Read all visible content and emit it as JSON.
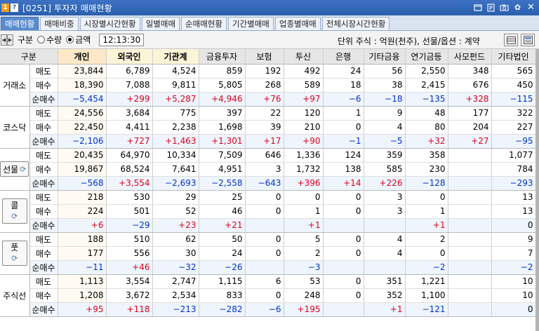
{
  "titlebar": {
    "badge1": "1",
    "badge2": "?",
    "title": "[0251] 투자자 매매현황",
    "icons": [
      "window-icon",
      "edit-icon",
      "camera-icon",
      "gear-icon",
      "close-icon"
    ]
  },
  "tabs": [
    {
      "label": "매매현황",
      "active": true
    },
    {
      "label": "매매비중",
      "active": false
    },
    {
      "label": "시장별시간현황",
      "active": false
    },
    {
      "label": "일별매매",
      "active": false
    },
    {
      "label": "순매매현황",
      "active": false
    },
    {
      "label": "기간별매매",
      "active": false
    },
    {
      "label": "업종별매매",
      "active": false
    },
    {
      "label": "전체시장시간현황",
      "active": false
    }
  ],
  "toolbar": {
    "gubun_label": "구분",
    "radio_qty": "수량",
    "radio_amt": "금액",
    "selected": "금액",
    "time": "12:13:30",
    "unit_text": "단위 주식 : 억원(천주), 선물/옵션 : 계약"
  },
  "table": {
    "header_gubun": "구분",
    "columns": [
      "개인",
      "외국인",
      "기관계",
      "금융투자",
      "보험",
      "투신",
      "은행",
      "기타금융",
      "연기금등",
      "사모펀드",
      "기타법인"
    ],
    "row_labels": [
      "매도",
      "매수",
      "순매수"
    ],
    "colors": {
      "positive": "#e0001b",
      "negative": "#0032c8"
    },
    "groups": [
      {
        "name": "거래소",
        "sell": [
          "23,844",
          "6,789",
          "4,524",
          "859",
          "192",
          "492",
          "24",
          "56",
          "2,550",
          "348",
          "565"
        ],
        "buy": [
          "18,390",
          "7,088",
          "9,811",
          "5,805",
          "268",
          "589",
          "18",
          "38",
          "2,415",
          "676",
          "450"
        ],
        "net": [
          "−5,454",
          "+299",
          "+5,287",
          "+4,946",
          "+76",
          "+97",
          "−6",
          "−18",
          "−135",
          "+328",
          "−115"
        ]
      },
      {
        "name": "코스닥",
        "sell": [
          "24,556",
          "3,684",
          "775",
          "397",
          "22",
          "120",
          "1",
          "9",
          "48",
          "177",
          "322"
        ],
        "buy": [
          "22,450",
          "4,411",
          "2,238",
          "1,698",
          "39",
          "210",
          "0",
          "4",
          "80",
          "204",
          "227"
        ],
        "net": [
          "−2,106",
          "+727",
          "+1,463",
          "+1,301",
          "+17",
          "+90",
          "−1",
          "−5",
          "+32",
          "+27",
          "−95"
        ]
      },
      {
        "name": "선물",
        "sell": [
          "20,435",
          "64,970",
          "10,334",
          "7,509",
          "646",
          "1,336",
          "124",
          "359",
          "358",
          "",
          "1,077"
        ],
        "buy": [
          "19,867",
          "68,524",
          "7,641",
          "4,951",
          "3",
          "1,732",
          "138",
          "585",
          "230",
          "",
          "784"
        ],
        "net": [
          "−568",
          "+3,554",
          "−2,693",
          "−2,558",
          "−643",
          "+396",
          "+14",
          "+226",
          "−128",
          "",
          "−293"
        ]
      },
      {
        "name": "콜",
        "sell": [
          "218",
          "530",
          "29",
          "25",
          "0",
          "0",
          "0",
          "3",
          "0",
          "",
          "13"
        ],
        "buy": [
          "224",
          "501",
          "52",
          "46",
          "0",
          "1",
          "0",
          "3",
          "1",
          "",
          "13"
        ],
        "net": [
          "+6",
          "−29",
          "+23",
          "+21",
          "",
          "+1",
          "",
          "",
          "+1",
          "",
          "0"
        ]
      },
      {
        "name": "풋",
        "sell": [
          "188",
          "510",
          "62",
          "50",
          "0",
          "5",
          "0",
          "4",
          "2",
          "",
          "9"
        ],
        "buy": [
          "177",
          "556",
          "30",
          "24",
          "0",
          "2",
          "0",
          "4",
          "0",
          "",
          "7"
        ],
        "net": [
          "−11",
          "+46",
          "−32",
          "−26",
          "",
          "−3",
          "",
          "",
          "−2",
          "",
          "−2"
        ]
      },
      {
        "name": "주식선",
        "sell": [
          "1,113",
          "3,554",
          "2,747",
          "1,115",
          "6",
          "53",
          "0",
          "351",
          "1,221",
          "",
          "10"
        ],
        "buy": [
          "1,208",
          "3,672",
          "2,534",
          "833",
          "0",
          "248",
          "0",
          "352",
          "1,100",
          "",
          "10"
        ],
        "net": [
          "+95",
          "+118",
          "−213",
          "−282",
          "−6",
          "+195",
          "",
          "+1",
          "−121",
          "",
          "0"
        ]
      }
    ]
  }
}
